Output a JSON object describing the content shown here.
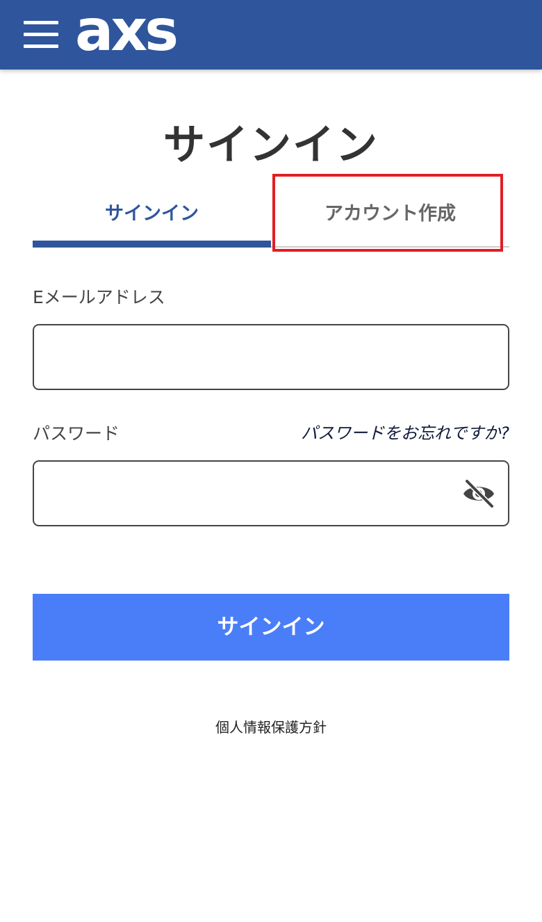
{
  "header": {
    "logo_text": "axs",
    "menu_icon": "hamburger-menu-icon",
    "brand_color": "#2f559c"
  },
  "page": {
    "title": "サインイン"
  },
  "tabs": [
    {
      "label": "サインイン",
      "active": true
    },
    {
      "label": "アカウント作成",
      "active": false
    }
  ],
  "form": {
    "email_label": "Eメールアドレス",
    "email_value": "",
    "password_label": "パスワード",
    "password_value": "",
    "forgot_password": "パスワードをお忘れですか?",
    "visibility_icon": "eye-off-icon",
    "submit_label": "サインイン",
    "submit_color": "#4a7ef8"
  },
  "footer": {
    "privacy_link": "個人情報保護方針"
  },
  "annotation": {
    "highlight_color": "#e11e25"
  }
}
